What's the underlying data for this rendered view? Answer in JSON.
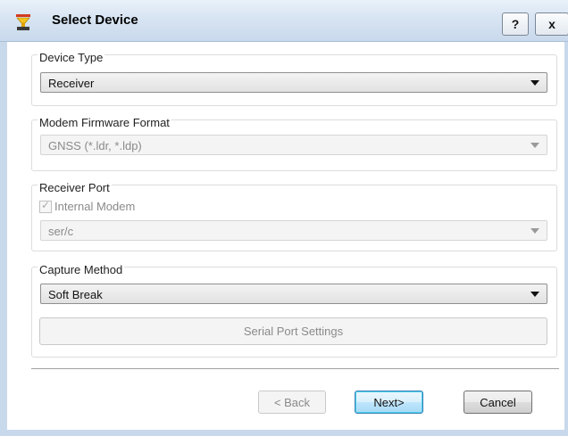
{
  "window": {
    "title": "Select Device",
    "help_label": "?",
    "close_label": "x"
  },
  "device_type": {
    "legend": "Device Type",
    "selected": "Receiver"
  },
  "firmware": {
    "legend": "Modem Firmware Format",
    "selected": "GNSS (*.ldr, *.ldp)"
  },
  "receiver_port": {
    "legend": "Receiver Port",
    "internal_modem_label": "Internal Modem",
    "internal_modem_checked": true,
    "port_selected": "ser/c"
  },
  "capture_method": {
    "legend": "Capture Method",
    "selected": "Soft Break",
    "serial_settings_label": "Serial Port Settings"
  },
  "buttons": {
    "back": "< Back",
    "next": "Next>",
    "cancel": "Cancel"
  },
  "icons": {
    "title_icon": "device-receiver-icon",
    "dropdown_arrow": "chevron-down-icon",
    "checkmark": "checkmark-icon"
  },
  "colors": {
    "titlebar": "#d7e4f2",
    "frame": "#c9d9ec",
    "default_button_border": "#3c7fb1",
    "disabled_text": "#8a8a8a"
  }
}
